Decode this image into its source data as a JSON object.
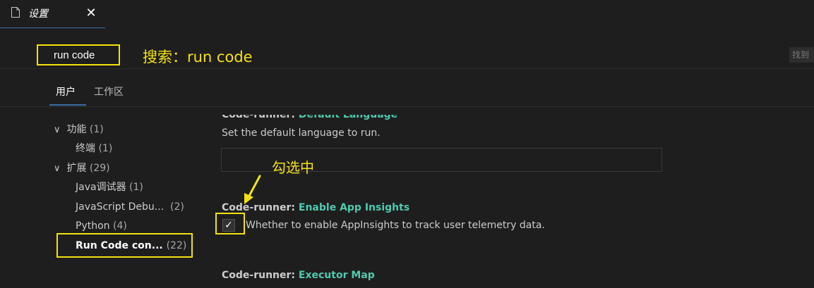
{
  "tab": {
    "title": "设置",
    "close_icon": "close-icon",
    "file_icon": "file-icon"
  },
  "search": {
    "value": "run code",
    "annotation": "搜索：run code",
    "found_label": "找到"
  },
  "scopes": [
    {
      "label": "用户",
      "active": true
    },
    {
      "label": "工作区",
      "active": false
    }
  ],
  "toc": {
    "items": [
      {
        "label": "功能",
        "count": "(1)",
        "expandable": true
      },
      {
        "label": "终端",
        "count": "(1)",
        "expandable": false
      },
      {
        "label": "扩展",
        "count": "(29)",
        "expandable": true
      },
      {
        "label": "Java调试器",
        "count": "(1)",
        "expandable": false
      },
      {
        "label": "JavaScript Debu...",
        "count": "(2)",
        "expandable": false
      },
      {
        "label": "Python",
        "count": "(4)",
        "expandable": false
      },
      {
        "label": "Run Code con...",
        "count": "(22)",
        "expandable": false,
        "selected": true
      }
    ]
  },
  "settings": {
    "default_language": {
      "category": "Code-runner: ",
      "name": "Default Language",
      "description": "Set the default language to run.",
      "value": ""
    },
    "enable_app_insights": {
      "category": "Code-runner: ",
      "name": "Enable App Insights",
      "description": "Whether to enable AppInsights to track user telemetry data.",
      "checked": true
    },
    "executor_map": {
      "category": "Code-runner: ",
      "name": "Executor Map"
    }
  },
  "annotations": {
    "checked": "勾选中",
    "highlight_color": "#f3e20f"
  },
  "colors": {
    "background": "#1e1e1e",
    "accent": "#3b6ea5",
    "setting_name": "#4ec9b0"
  }
}
